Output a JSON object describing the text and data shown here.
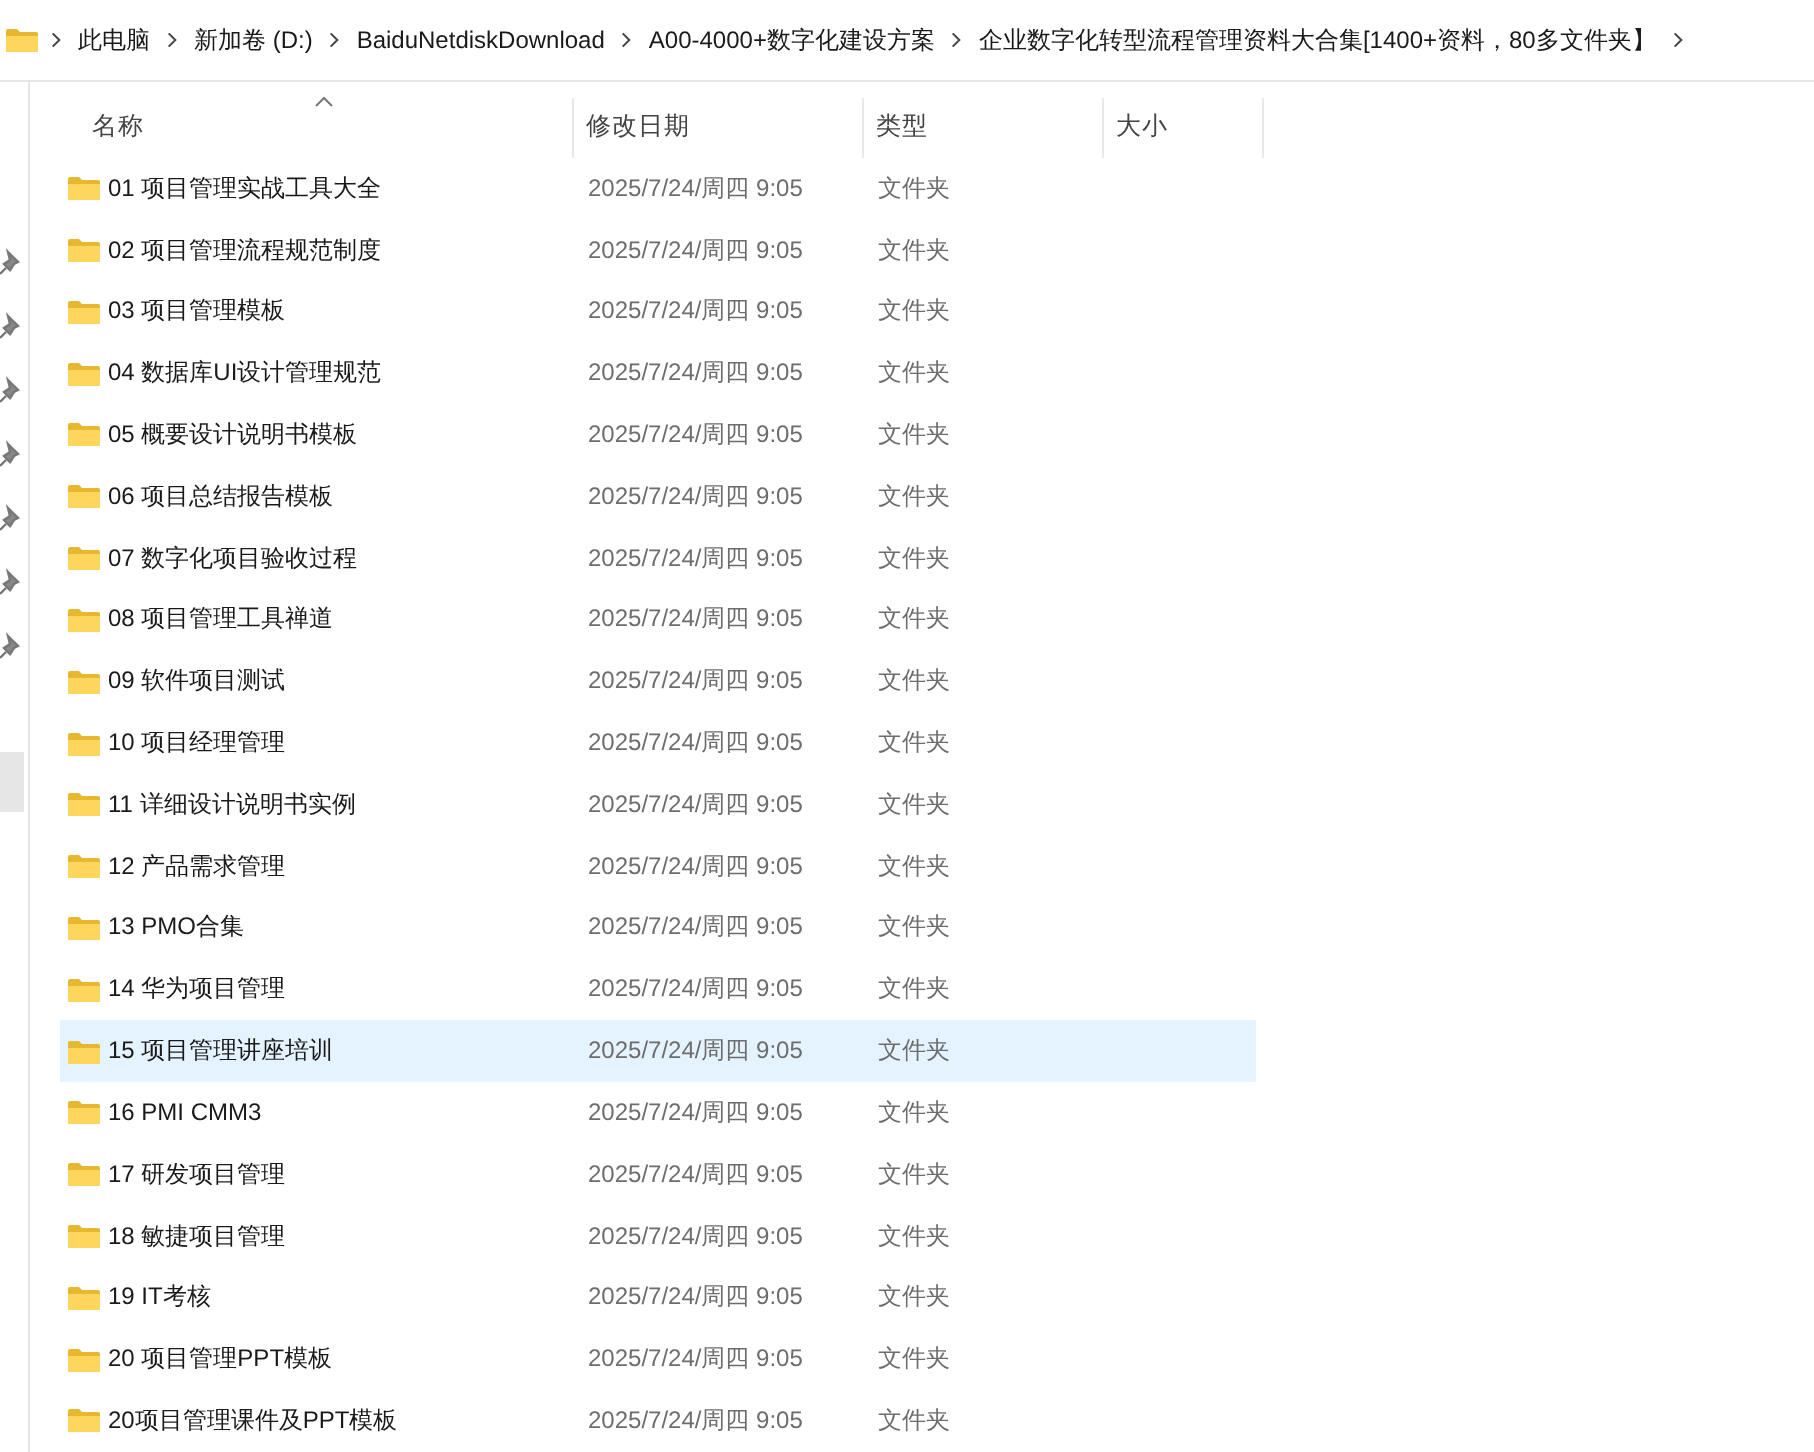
{
  "breadcrumb": [
    "此电脑",
    "新加卷 (D:)",
    "BaiduNetdiskDownload",
    "A00-4000+数字化建设方案",
    "企业数字化转型流程管理资料大合集[1400+资料，80多文件夹】"
  ],
  "columns": [
    {
      "label": "名称",
      "sorted": true
    },
    {
      "label": "修改日期",
      "sorted": false
    },
    {
      "label": "类型",
      "sorted": false
    },
    {
      "label": "大小",
      "sorted": false
    }
  ],
  "rows": [
    {
      "name": "01 项目管理实战工具大全",
      "date": "2025/7/24/周四 9:05",
      "type": "文件夹",
      "selected": false
    },
    {
      "name": "02 项目管理流程规范制度",
      "date": "2025/7/24/周四 9:05",
      "type": "文件夹",
      "selected": false
    },
    {
      "name": "03 项目管理模板",
      "date": "2025/7/24/周四 9:05",
      "type": "文件夹",
      "selected": false
    },
    {
      "name": "04 数据库UI设计管理规范",
      "date": "2025/7/24/周四 9:05",
      "type": "文件夹",
      "selected": false
    },
    {
      "name": "05 概要设计说明书模板",
      "date": "2025/7/24/周四 9:05",
      "type": "文件夹",
      "selected": false
    },
    {
      "name": "06 项目总结报告模板",
      "date": "2025/7/24/周四 9:05",
      "type": "文件夹",
      "selected": false
    },
    {
      "name": "07 数字化项目验收过程",
      "date": "2025/7/24/周四 9:05",
      "type": "文件夹",
      "selected": false
    },
    {
      "name": "08 项目管理工具禅道",
      "date": "2025/7/24/周四 9:05",
      "type": "文件夹",
      "selected": false
    },
    {
      "name": "09 软件项目测试",
      "date": "2025/7/24/周四 9:05",
      "type": "文件夹",
      "selected": false
    },
    {
      "name": "10 项目经理管理",
      "date": "2025/7/24/周四 9:05",
      "type": "文件夹",
      "selected": false
    },
    {
      "name": "11 详细设计说明书实例",
      "date": "2025/7/24/周四 9:05",
      "type": "文件夹",
      "selected": false
    },
    {
      "name": "12 产品需求管理",
      "date": "2025/7/24/周四 9:05",
      "type": "文件夹",
      "selected": false
    },
    {
      "name": "13 PMO合集",
      "date": "2025/7/24/周四 9:05",
      "type": "文件夹",
      "selected": false
    },
    {
      "name": "14 华为项目管理",
      "date": "2025/7/24/周四 9:05",
      "type": "文件夹",
      "selected": false
    },
    {
      "name": "15 项目管理讲座培训",
      "date": "2025/7/24/周四 9:05",
      "type": "文件夹",
      "selected": true
    },
    {
      "name": "16 PMI CMM3",
      "date": "2025/7/24/周四 9:05",
      "type": "文件夹",
      "selected": false
    },
    {
      "name": "17 研发项目管理",
      "date": "2025/7/24/周四 9:05",
      "type": "文件夹",
      "selected": false
    },
    {
      "name": "18 敏捷项目管理",
      "date": "2025/7/24/周四 9:05",
      "type": "文件夹",
      "selected": false
    },
    {
      "name": "19 IT考核",
      "date": "2025/7/24/周四 9:05",
      "type": "文件夹",
      "selected": false
    },
    {
      "name": "20 项目管理PPT模板",
      "date": "2025/7/24/周四 9:05",
      "type": "文件夹",
      "selected": false
    },
    {
      "name": "20项目管理课件及PPT模板",
      "date": "2025/7/24/周四 9:05",
      "type": "文件夹",
      "selected": false
    }
  ]
}
